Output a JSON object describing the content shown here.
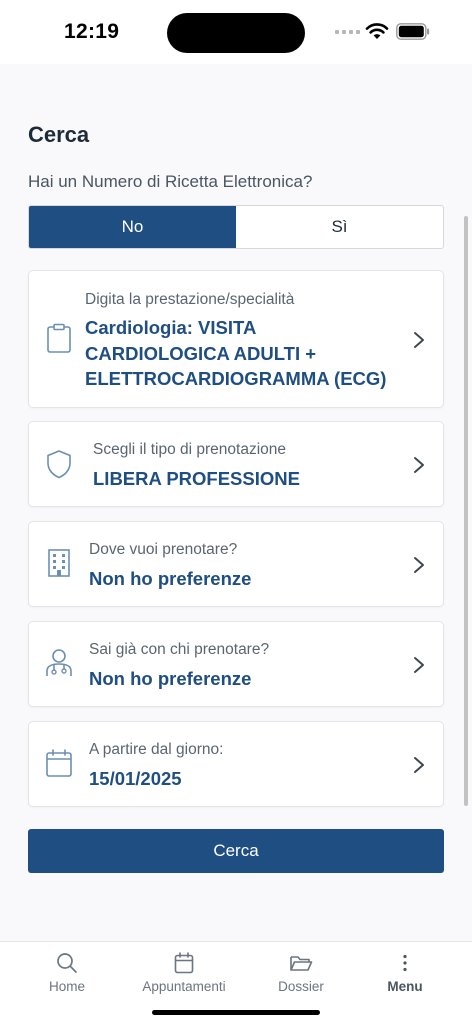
{
  "status": {
    "time": "12:19"
  },
  "page": {
    "title": "Cerca",
    "question": "Hai un Numero di Ricetta Elettronica?"
  },
  "toggle": {
    "no_label": "No",
    "yes_label": "Sì",
    "selected": "No"
  },
  "cards": [
    {
      "label": "Digita la prestazione/specialità",
      "value_lines": [
        "Cardiologia: VISITA",
        "CARDIOLOGICA ADULTI +",
        "ELETTROCARDIOGRAMMA (ECG)"
      ],
      "icon": "clipboard-icon"
    },
    {
      "label": "Scegli il tipo di prenotazione",
      "value": "LIBERA PROFESSIONE",
      "icon": "shield-icon"
    },
    {
      "label": "Dove vuoi prenotare?",
      "value": "Non ho preferenze",
      "icon": "building-icon"
    },
    {
      "label": "Sai già con chi prenotare?",
      "value": "Non ho preferenze",
      "icon": "doctor-icon"
    },
    {
      "label": "A partire dal giorno:",
      "value": "15/01/2025",
      "icon": "calendar-icon"
    }
  ],
  "search_button": {
    "label": "Cerca"
  },
  "tabbar": {
    "active": "Menu",
    "items": [
      {
        "label": "Home",
        "icon": "search-icon"
      },
      {
        "label": "Appuntamenti",
        "icon": "calendar-icon"
      },
      {
        "label": "Dossier",
        "icon": "folder-icon"
      },
      {
        "label": "Menu",
        "icon": "more-vertical-icon"
      }
    ]
  },
  "colors": {
    "primary": "#1f4e82",
    "icon": "#6c8fb2",
    "background": "#f9f9fb"
  }
}
